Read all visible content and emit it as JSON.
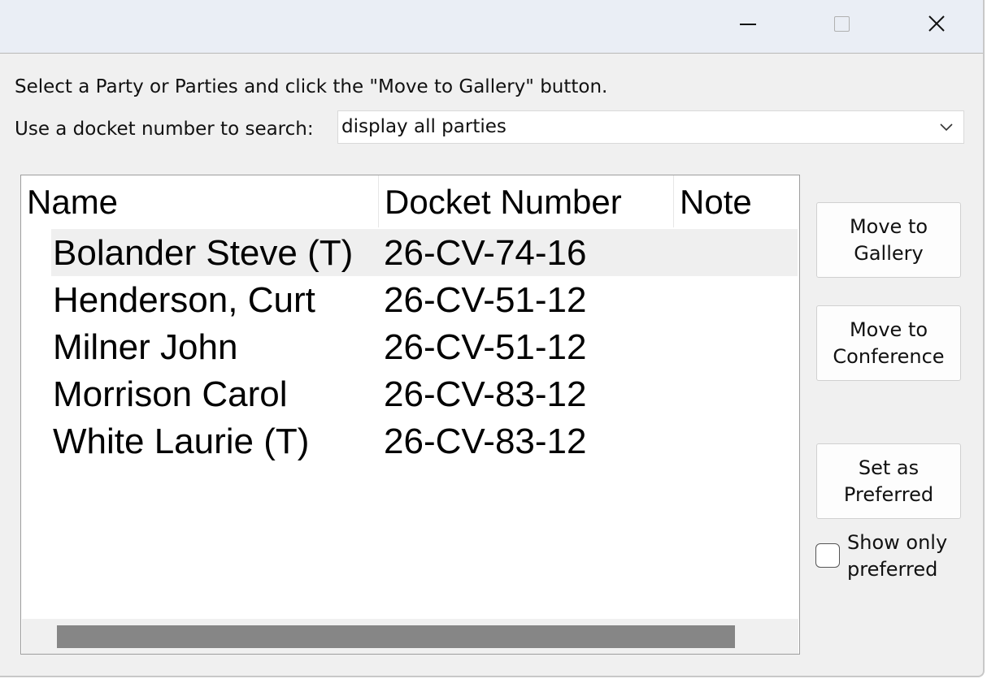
{
  "titlebar": {
    "minimize_icon": "minimize-icon",
    "maximize_icon": "maximize-icon",
    "close_icon": "close-icon"
  },
  "instructions": "Select a Party or Parties and click the \"Move to Gallery\" button.",
  "search": {
    "label": "Use a docket number to search:",
    "selected_value": "display all parties"
  },
  "table": {
    "columns": [
      "Name",
      "Docket Number",
      "Note"
    ],
    "rows": [
      {
        "name": "Bolander Steve (T)",
        "docket": "26-CV-74-16",
        "note": "",
        "selected": true
      },
      {
        "name": "Henderson, Curt",
        "docket": "26-CV-51-12",
        "note": ""
      },
      {
        "name": "Milner John",
        "docket": "26-CV-51-12",
        "note": ""
      },
      {
        "name": "Morrison Carol",
        "docket": "26-CV-83-12",
        "note": ""
      },
      {
        "name": "White Laurie (T)",
        "docket": "26-CV-83-12",
        "note": ""
      }
    ]
  },
  "buttons": {
    "move_to_gallery": "Move to Gallery",
    "move_to_conference": "Move to Conference",
    "set_as_preferred": "Set as Preferred"
  },
  "show_only_preferred": {
    "label": "Show only preferred",
    "checked": false
  }
}
